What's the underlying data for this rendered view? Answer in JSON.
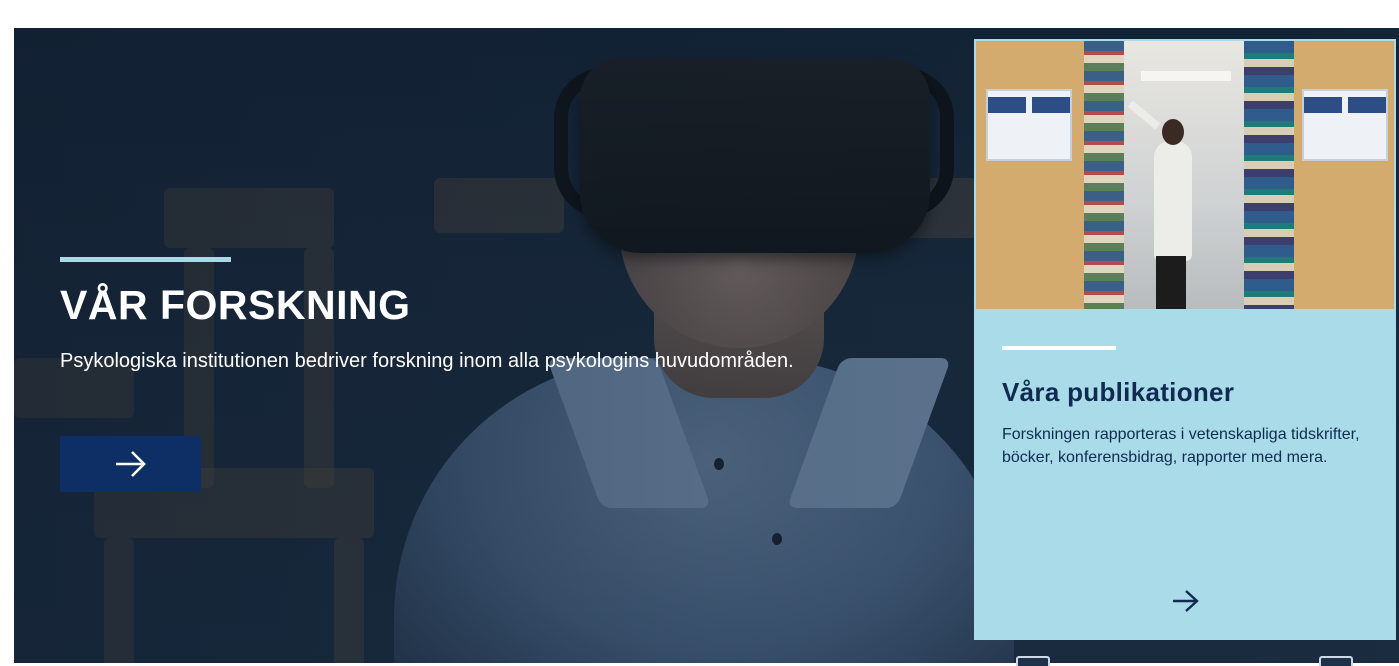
{
  "hero": {
    "title": "VÅR FORSKNING",
    "description": "Psykologiska institutionen bedriver forskning inom alla psykologins huvudområden.",
    "button_icon": "arrow-right-icon",
    "accent_color": "#a9d9e6",
    "button_color": "#0d2f66"
  },
  "card": {
    "title": "Våra publikationer",
    "description": "Forskningen rapporteras i vetenskapliga tidskrifter, böcker, konferensbidrag, rapporter med mera.",
    "button_icon": "arrow-right-icon",
    "background_color": "#a9dce8",
    "text_color": "#102a52"
  },
  "carousel": {
    "prev_icon": "slider-prev-icon",
    "next_icon": "slider-next-icon"
  }
}
